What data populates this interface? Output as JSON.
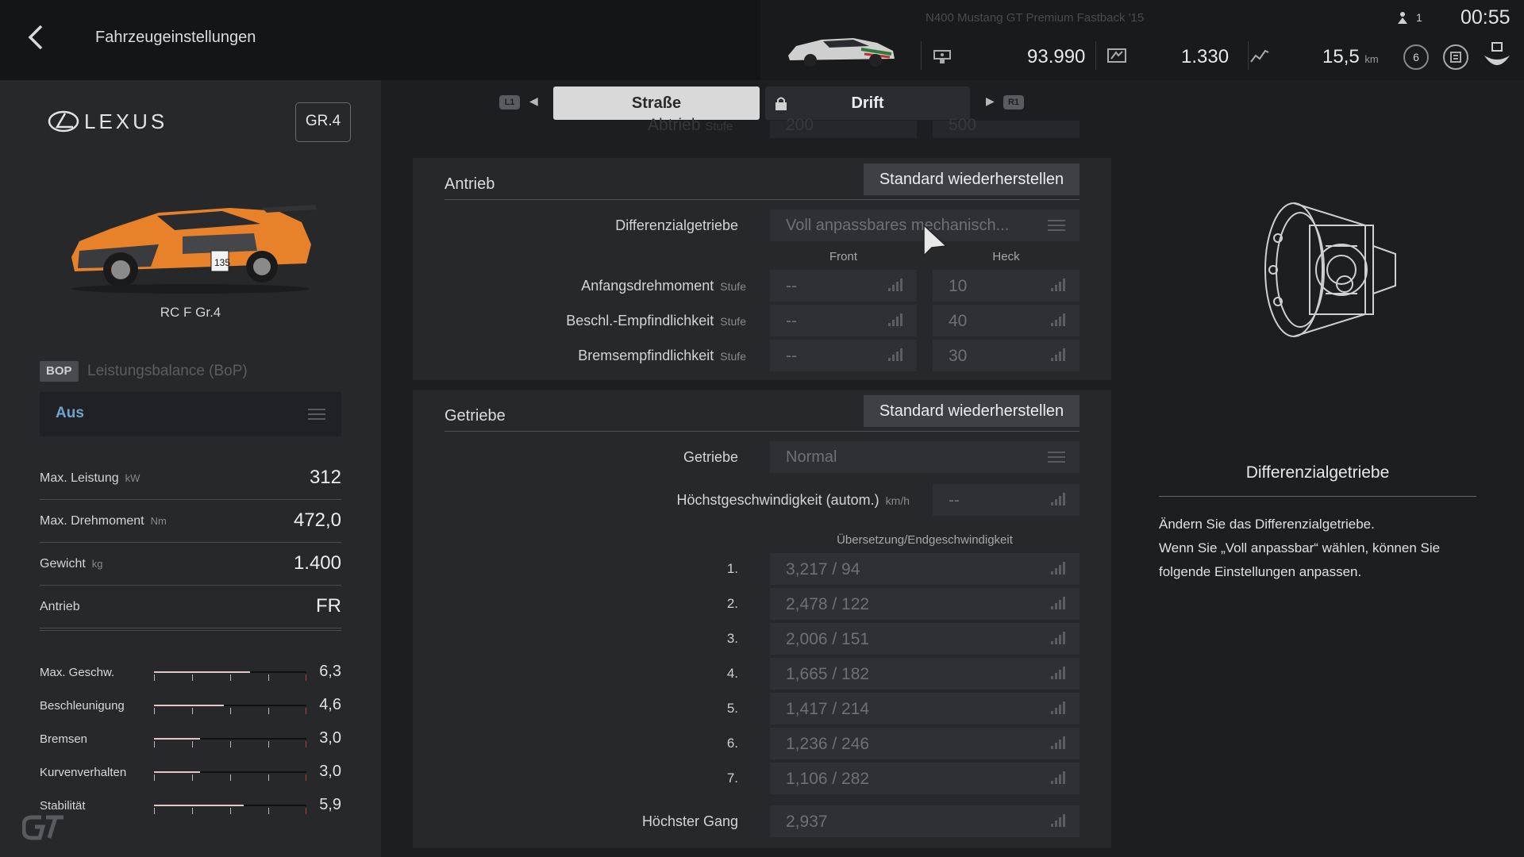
{
  "header": {
    "title": "Fahrzeugeinstellungen"
  },
  "top_status": {
    "car_label": "N400  Mustang GT Premium Fastback '15",
    "credits": "93.990",
    "pp": "1.330",
    "distance": "15,5",
    "distance_unit": "km",
    "level": "6",
    "players": "1",
    "time": "00:55"
  },
  "car": {
    "brand": "LEXUS",
    "class_badge": "GR.4",
    "model": "RC F Gr.4",
    "number": "135"
  },
  "bop": {
    "badge": "BOP",
    "label": "Leistungsbalance (BoP)",
    "value": "Aus"
  },
  "stats": [
    {
      "label": "Max. Leistung",
      "unit": "kW",
      "value": "312"
    },
    {
      "label": "Max. Drehmoment",
      "unit": "Nm",
      "value": "472,0"
    },
    {
      "label": "Gewicht",
      "unit": "kg",
      "value": "1.400"
    },
    {
      "label": "Antrieb",
      "unit": "",
      "value": "FR"
    }
  ],
  "ratings": [
    {
      "label": "Max. Geschw.",
      "value": "6,3",
      "level": 0.63
    },
    {
      "label": "Beschleunigung",
      "value": "4,6",
      "level": 0.46
    },
    {
      "label": "Bremsen",
      "value": "3,0",
      "level": 0.3
    },
    {
      "label": "Kurvenverhalten",
      "value": "3,0",
      "level": 0.3
    },
    {
      "label": "Stabilität",
      "value": "5,9",
      "level": 0.59
    }
  ],
  "tabs": {
    "hint_left": "L1",
    "hint_right": "R1",
    "active": "Straße",
    "inactive": "Drift"
  },
  "ghost": {
    "label": "Abtrieb",
    "unit": "Stufe",
    "front": "200",
    "rear": "500"
  },
  "antrieb": {
    "title": "Antrieb",
    "reset_label": "Standard wiederherstellen",
    "diff_label": "Differenzialgetriebe",
    "diff_value": "Voll anpassbares mechanisch...",
    "col_front": "Front",
    "col_rear": "Heck",
    "unit": "Stufe",
    "rows": [
      {
        "label": "Anfangsdrehmoment",
        "front": "--",
        "rear": "10"
      },
      {
        "label": "Beschl.-Empfindlichkeit",
        "front": "--",
        "rear": "40"
      },
      {
        "label": "Bremsempfindlichkeit",
        "front": "--",
        "rear": "30"
      }
    ]
  },
  "getriebe": {
    "title": "Getriebe",
    "reset_label": "Standard wiederherstellen",
    "trans_label": "Getriebe",
    "trans_value": "Normal",
    "topspeed_label": "Höchstgeschwindigkeit (autom.)",
    "topspeed_unit": "km/h",
    "topspeed_value": "--",
    "ratio_header": "Übersetzung/Endgeschwindigkeit",
    "gears": [
      {
        "n": "1.",
        "value": "3,217 / 94"
      },
      {
        "n": "2.",
        "value": "2,478 / 122"
      },
      {
        "n": "3.",
        "value": "2,006 / 151"
      },
      {
        "n": "4.",
        "value": "1,665 / 182"
      },
      {
        "n": "5.",
        "value": "1,417 / 214"
      },
      {
        "n": "6.",
        "value": "1,236 / 246"
      },
      {
        "n": "7.",
        "value": "1,106 / 282"
      }
    ],
    "top_gear_label": "Höchster Gang",
    "top_gear_value": "2,937"
  },
  "info": {
    "title": "Differenzialgetriebe",
    "lines": [
      "Ändern Sie das Differenzialgetriebe.",
      "Wenn Sie „Voll anpassbar“ wählen, können Sie",
      "folgende Einstellungen anpassen."
    ]
  },
  "colors": {
    "accent_blue": "#6ea4cf",
    "rating_fill": "#e4c6c8",
    "rating_limit": "#c4343c"
  }
}
